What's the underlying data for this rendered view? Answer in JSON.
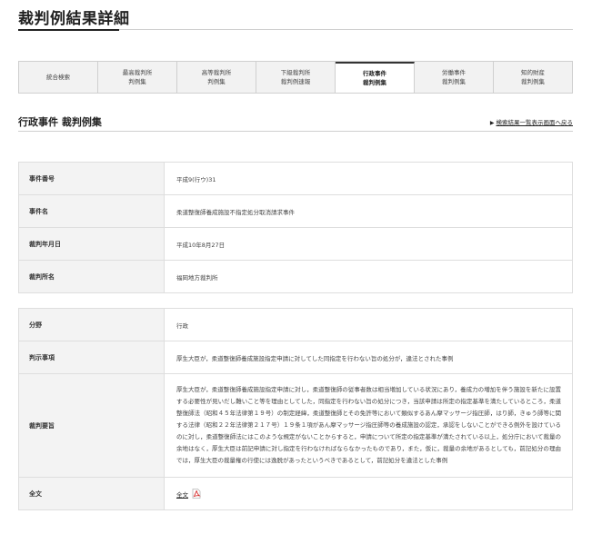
{
  "page": {
    "title": "裁判例結果詳細"
  },
  "tabs": [
    {
      "label": "統合検索",
      "active": false
    },
    {
      "label": "最高裁判所\n判例集",
      "active": false
    },
    {
      "label": "高等裁判所\n判例集",
      "active": false
    },
    {
      "label": "下級裁判所\n裁判例速報",
      "active": false
    },
    {
      "label": "行政事件\n裁判例集",
      "active": true
    },
    {
      "label": "労働事件\n裁判例集",
      "active": false
    },
    {
      "label": "知的財産\n裁判例集",
      "active": false
    }
  ],
  "section": {
    "title": "行政事件 裁判例集",
    "back_link": "検索結果一覧表示画面へ戻る"
  },
  "case_info": [
    {
      "label": "事件番号",
      "value": "平成9(行ウ)31"
    },
    {
      "label": "事件名",
      "value": "柔道整復師養成施設不指定処分取消請求事件"
    },
    {
      "label": "裁判年月日",
      "value": "平成10年8月27日"
    },
    {
      "label": "裁判所名",
      "value": "福岡地方裁判所"
    }
  ],
  "details": {
    "field_label": "分野",
    "field_value": "行政",
    "holding_label": "判示事項",
    "holding_value": "厚生大臣が，柔道整復師養成施設指定申請に対してした同指定を行わない旨の処分が，違法とされた事例",
    "summary_label": "裁判要旨",
    "summary_value": "厚生大臣が，柔道整復師養成施設指定申請に対し，柔道整復師の従事者数は相当増加している状況にあり，養成力の増加を伴う施設を新たに設置する必要性が見いだし難いこと等を理由としてした，同指定を行わない旨の処分につき，当該申請は所定の指定基準を満たしているところ，柔道整復師法（昭和４５年法律第１９号）の制定経緯，柔道整復師とその免許等において類似するあん摩マッサージ指圧師，はり師，きゅう師等に関する法律（昭和２２年法律第２１７号）１９条１項があん摩マッサージ指圧師等の養成施設の認定，承認をしないことができる例外を設けているのに対し，柔道整復師法にはこのような規定がないことからすると，申請について所定の指定基準が満たされている以上，処分庁において裁量の余地はなく，厚生大臣は前記申請に対し指定を行わなければならなかったものであり，また，仮に，裁量の余地があるとしても，前記処分の理由では，厚生大臣の裁量権の行使には逸脱があったというべきであるとして，前記処分を違法とした事例",
    "fulltext_label": "全文",
    "fulltext_link": "全文",
    "pdf_icon": "pdf-icon"
  },
  "colors": {
    "active_tab_border": "#333333",
    "tab_bg": "#f2f2f2",
    "header_cell_bg": "#f3f3f3",
    "pdf_red": "#d62b2b"
  }
}
